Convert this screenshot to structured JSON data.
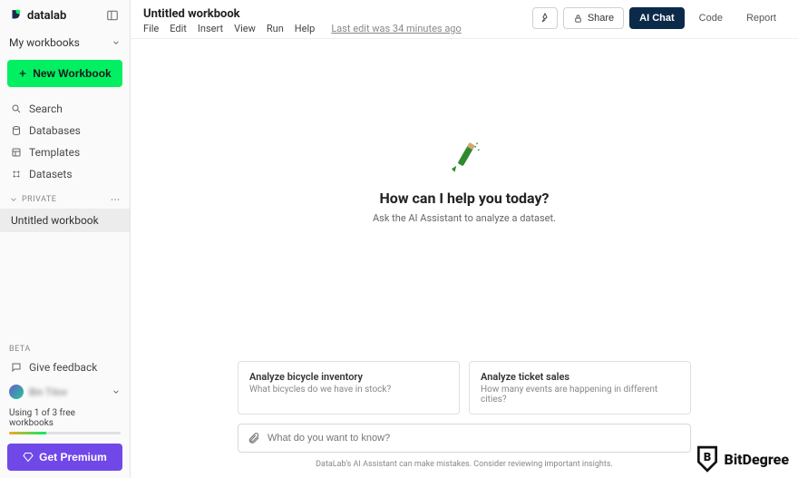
{
  "brand": "datalab",
  "sidebar": {
    "selector_label": "My workbooks",
    "new_wb": "New Workbook",
    "nav": {
      "search": "Search",
      "databases": "Databases",
      "templates": "Templates",
      "datasets": "Datasets"
    },
    "section_label": "PRIVATE",
    "workbook_item": "Untitled workbook",
    "beta": "BETA",
    "feedback": "Give feedback",
    "user_name": "Bin Titov",
    "usage_text": "Using 1 of 3 free workbooks",
    "premium": "Get Premium"
  },
  "header": {
    "title": "Untitled workbook",
    "menu": {
      "file": "File",
      "edit": "Edit",
      "insert": "Insert",
      "view": "View",
      "run": "Run",
      "help": "Help"
    },
    "last_edit": "Last edit was 34 minutes ago",
    "actions": {
      "share": "Share",
      "ai_chat": "AI Chat",
      "code": "Code",
      "report": "Report"
    }
  },
  "hero": {
    "title": "How can I help you today?",
    "subtitle": "Ask the AI Assistant to analyze a dataset."
  },
  "suggestions": [
    {
      "title": "Analyze bicycle inventory",
      "desc": "What bicycles do we have in stock?"
    },
    {
      "title": "Analyze ticket sales",
      "desc": "How many events are happening in different cities?"
    }
  ],
  "input_placeholder": "What do you want to know?",
  "disclaimer": "DataLab's AI Assistant can make mistakes. Consider reviewing important insights.",
  "watermark": "BitDegree"
}
